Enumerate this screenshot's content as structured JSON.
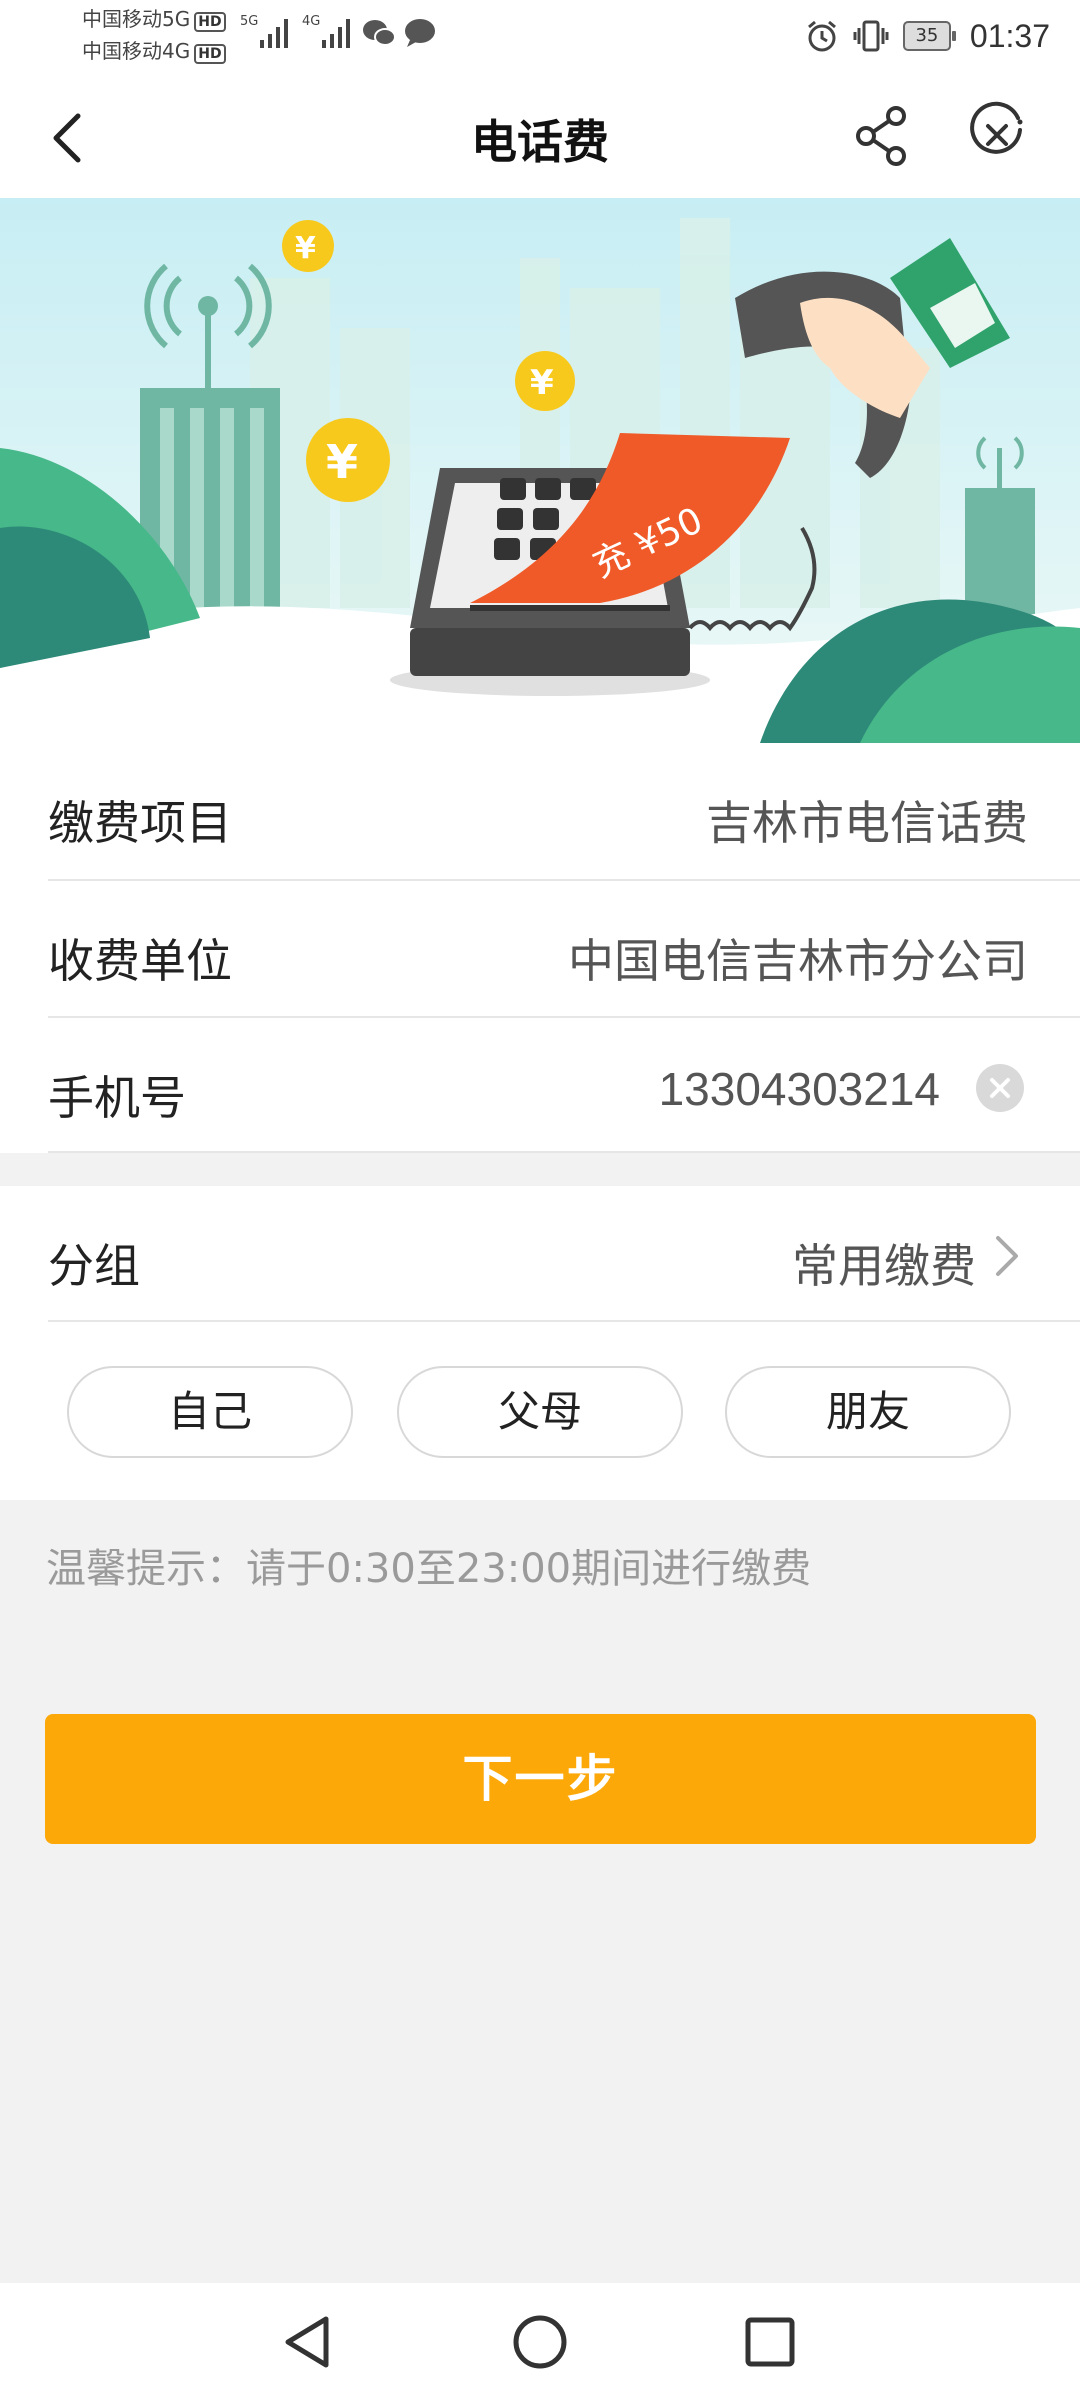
{
  "status_bar": {
    "carrier1": "中国移动5G",
    "carrier2": "中国移动4G",
    "hd1": "HD",
    "hd2": "HD",
    "sig1_label": "5G",
    "sig2_label": "4G",
    "battery": "35",
    "time": "01:37"
  },
  "header": {
    "title": "电话费"
  },
  "banner": {
    "ticket_text": "充 ¥50",
    "coin_symbol": "¥"
  },
  "form": {
    "item_label": "缴费项目",
    "item_value": "吉林市电信话费",
    "unit_label": "收费单位",
    "unit_value": "中国电信吉林市分公司",
    "phone_label": "手机号",
    "phone_value": "13304303214",
    "group_label": "分组",
    "group_value": "常用缴费"
  },
  "chips": [
    "自己",
    "父母",
    "朋友"
  ],
  "tip": "温馨提示：请于0:30至23:00期间进行缴费",
  "next_button": "下一步",
  "colors": {
    "accent": "#fca809",
    "background": "#f2f2f2",
    "phone_ticket": "#f05a28"
  }
}
